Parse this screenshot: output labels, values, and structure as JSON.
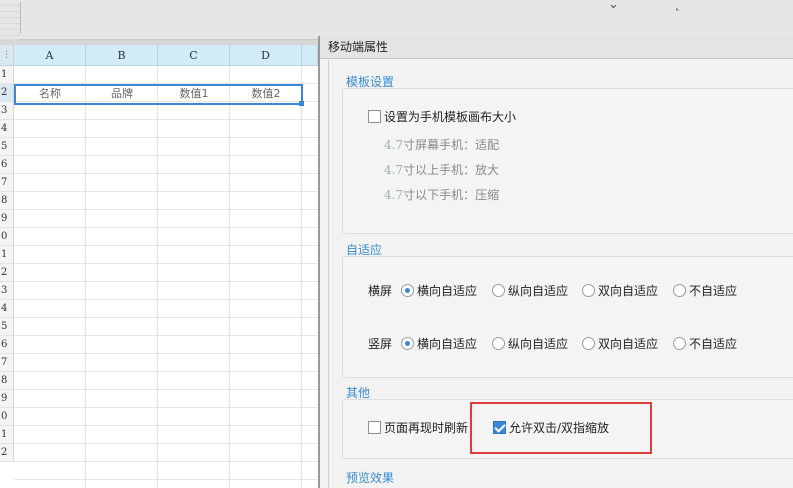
{
  "spreadsheet": {
    "columns": [
      "A",
      "B",
      "C",
      "D"
    ],
    "rows": [
      "1",
      "2",
      "3",
      "4",
      "5",
      "6",
      "7",
      "8",
      "9",
      "0",
      "1",
      "2",
      "3",
      "4",
      "5",
      "6",
      "7",
      "8",
      "9",
      "0",
      "1",
      "2"
    ],
    "row2_cells": [
      "名称",
      "品牌",
      "数值1",
      "数值2"
    ]
  },
  "panel": {
    "title": "移动端属性",
    "template_section": {
      "title": "模板设置",
      "checkbox_label": "设置为手机模板画布大小",
      "checked": false,
      "notes": [
        {
          "size": "4.7",
          "text": "寸屏幕手机：适配"
        },
        {
          "size": "4.7",
          "text": "寸以上手机：放大"
        },
        {
          "size": "4.7",
          "text": "寸以下手机：压缩"
        }
      ]
    },
    "adaptive_section": {
      "title": "自适应",
      "landscape": {
        "label": "横屏",
        "options": [
          "横向自适应",
          "纵向自适应",
          "双向自适应",
          "不自适应"
        ],
        "selected": "横向自适应"
      },
      "portrait": {
        "label": "竖屏",
        "options": [
          "横向自适应",
          "纵向自适应",
          "双向自适应",
          "不自适应"
        ],
        "selected": "横向自适应"
      }
    },
    "other_section": {
      "title": "其他",
      "refresh_label": "页面再现时刷新",
      "refresh_checked": false,
      "zoom_label": "允许双击/双指缩放",
      "zoom_checked": true
    },
    "preview_section": {
      "title": "预览效果"
    }
  },
  "colors": {
    "accent": "#3b86d6",
    "section_title": "#3a8ccf",
    "highlight_frame": "#e03b3b",
    "column_header": "#d2ecf7"
  }
}
